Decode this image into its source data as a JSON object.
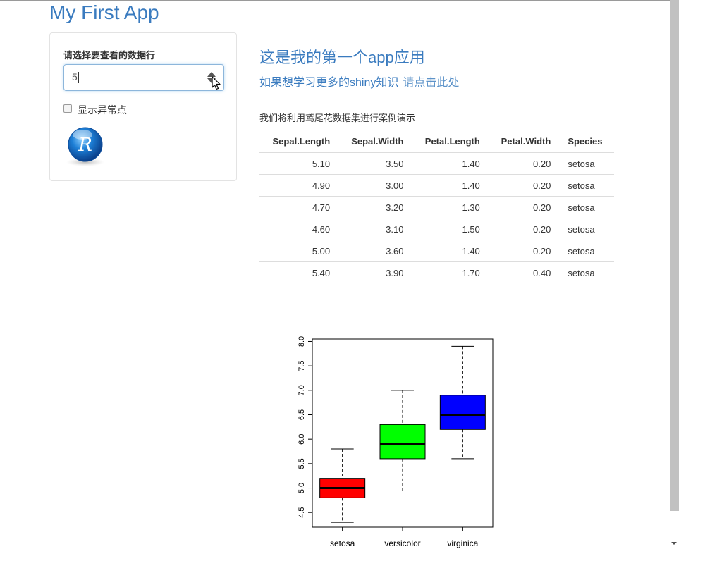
{
  "app": {
    "title": "My First App"
  },
  "sidebar": {
    "input_label": "请选择要查看的数据行",
    "input_value": "5",
    "checkbox_label": "显示异常点",
    "checkbox_checked": false,
    "logo_letter": "R"
  },
  "main": {
    "title": "这是我的第一个app应用",
    "link_prefix": "如果想学习更多的shiny知识",
    "link_text": "请点击此处",
    "description": "我们将利用鸢尾花数据集进行案例演示",
    "table": {
      "headers": [
        "Sepal.Length",
        "Sepal.Width",
        "Petal.Length",
        "Petal.Width",
        "Species"
      ],
      "rows": [
        [
          "5.10",
          "3.50",
          "1.40",
          "0.20",
          "setosa"
        ],
        [
          "4.90",
          "3.00",
          "1.40",
          "0.20",
          "setosa"
        ],
        [
          "4.70",
          "3.20",
          "1.30",
          "0.20",
          "setosa"
        ],
        [
          "4.60",
          "3.10",
          "1.50",
          "0.20",
          "setosa"
        ],
        [
          "5.00",
          "3.60",
          "1.40",
          "0.20",
          "setosa"
        ],
        [
          "5.40",
          "3.90",
          "1.70",
          "0.40",
          "setosa"
        ]
      ]
    }
  },
  "chart_data": {
    "type": "box",
    "categories": [
      "setosa",
      "versicolor",
      "virginica"
    ],
    "boxes": [
      {
        "name": "setosa",
        "min": 4.3,
        "q1": 4.8,
        "median": 5.0,
        "q3": 5.2,
        "max": 5.8,
        "color": "#ff0000"
      },
      {
        "name": "versicolor",
        "min": 4.9,
        "q1": 5.6,
        "median": 5.9,
        "q3": 6.3,
        "max": 7.0,
        "color": "#00ff00"
      },
      {
        "name": "virginica",
        "min": 5.6,
        "q1": 6.2,
        "median": 6.5,
        "q3": 6.9,
        "max": 7.9,
        "color": "#0000ff"
      }
    ],
    "yticks": [
      "4.5",
      "5.0",
      "5.5",
      "6.0",
      "6.5",
      "7.0",
      "7.5",
      "8.0"
    ],
    "ylim": [
      4.2,
      8.05
    ],
    "title": "",
    "xlabel": "",
    "ylabel": ""
  }
}
